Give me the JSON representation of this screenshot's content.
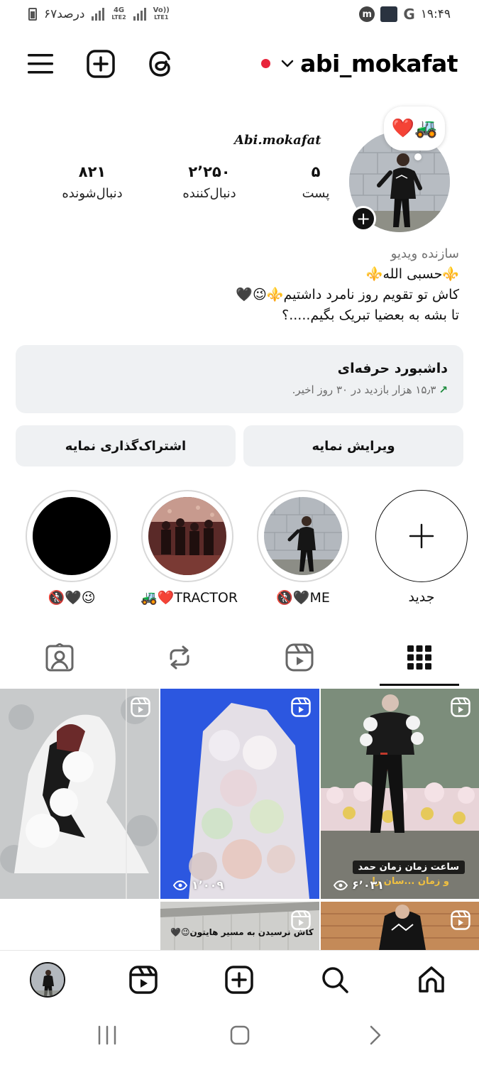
{
  "status_bar": {
    "time": "۱۹:۴۹",
    "battery_text": "۶۷درصد",
    "network1_label": "4G",
    "network1_sub": "LTE2",
    "network2_label": "Vo))",
    "network2_sub": "LTE1",
    "icons": [
      "mastodon-icon",
      "app-thumbnail-icon",
      "google-icon",
      "battery-icon",
      "signal-icon"
    ]
  },
  "header": {
    "username": "abi_mokafat",
    "icons": [
      "menu-icon",
      "create-icon",
      "threads-icon",
      "chevron-down-icon"
    ]
  },
  "profile": {
    "display_name": "Abi.mokafat",
    "note_emojis": "❤️🚜",
    "stats": [
      {
        "value": "۵",
        "label": "پست"
      },
      {
        "value": "۲٬۲۵۰",
        "label": "دنبال‌کننده"
      },
      {
        "value": "۸۲۱",
        "label": "دنبال‌شونده"
      }
    ],
    "category": "سازنده ویدیو",
    "bio_lines": [
      "⚜️حسبی الله⚜️",
      "کاش تو تقویم روز نامرد داشتیم⚜️😉🖤",
      "تا بشه به بعضیا تبریک بگیم.....؟"
    ]
  },
  "dashboard": {
    "title": "داشبورد حرفه‌ای",
    "arrow": "↗",
    "subtitle": "۱۵٫۳ هزار بازدید در ۳۰ روز اخیر."
  },
  "buttons": {
    "edit_profile": "ویرایش نمایه",
    "share_profile": "اشتراک‌گذاری نمایه"
  },
  "highlights": [
    {
      "label": "جدید",
      "is_new": true
    },
    {
      "label": "🚷🖤ME"
    },
    {
      "label": "🚜❤️TRACTOR"
    },
    {
      "label": "🚷🖤😉"
    }
  ],
  "tabs": [
    "grid-tab",
    "reels-tab",
    "reposts-tab",
    "tagged-tab"
  ],
  "grid": {
    "posts": [
      {
        "views": "۶٬۰۳۱",
        "caption_top": "ساعت زمان زمان حمد",
        "caption_bottom": "و زمان ...سان را"
      },
      {
        "views": "۱٬۰۰۹"
      },
      {
        "views": ""
      },
      {
        "caption": "کاش نرسیدن به مسیر هایتون😉🖤"
      },
      {
        "caption": ""
      }
    ]
  },
  "bottom_nav": [
    "home-icon",
    "search-icon",
    "create-icon",
    "reels-icon",
    "profile-avatar"
  ],
  "colors": {
    "accent": "#e8243b",
    "panel": "#eff1f3",
    "trend_green": "#1a8a3a",
    "text": "#111111",
    "muted": "#737373"
  }
}
